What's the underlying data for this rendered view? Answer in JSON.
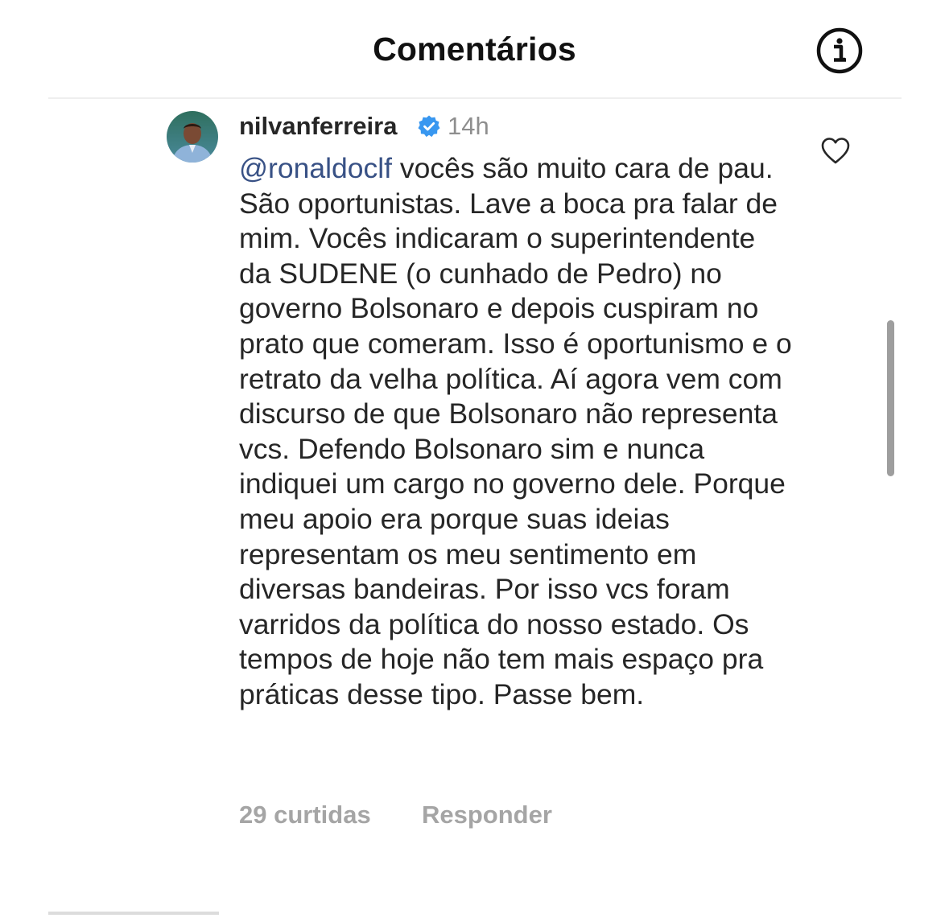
{
  "header": {
    "title": "Comentários",
    "info_icon": "info-circle-icon"
  },
  "comment": {
    "username": "nilvanferreira",
    "verified_icon": "verified-badge-icon",
    "verified_color": "#3897f0",
    "timestamp": "14h",
    "mention": "@ronaldoclf",
    "mention_color": "#385185",
    "body": " vocês são muito cara de pau. São oportunistas. Lave a boca pra falar de mim. Vocês indicaram o superintendente da SUDENE (o cunhado de Pedro) no governo Bolsonaro e depois cuspiram no prato que comeram. Isso é oportunismo e o retrato da velha política. Aí agora vem com discurso de que Bolsonaro não representa vcs. Defendo Bolsonaro sim e nunca indiquei um cargo no governo dele. Porque meu apoio era porque suas ideias representam os meu sentimento em diversas bandeiras. Por isso vcs foram varridos da política do nosso estado. Os tempos de hoje não tem mais espaço pra práticas desse tipo. Passe bem.",
    "likes": "29 curtidas",
    "reply_label": "Responder",
    "like_icon": "heart-outline-icon"
  }
}
